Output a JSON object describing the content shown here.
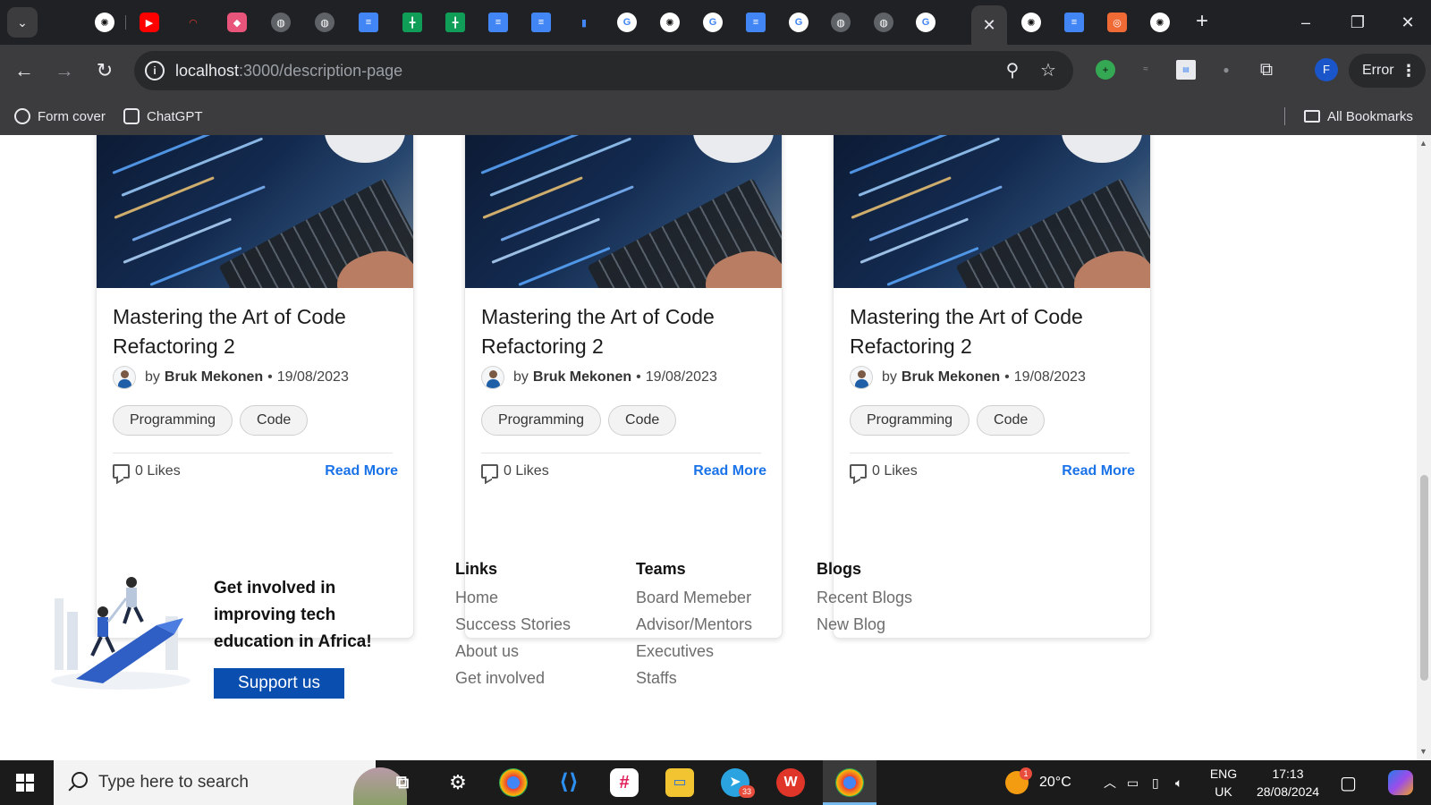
{
  "browser": {
    "url_host": "localhost",
    "url_path": ":3000/description-page",
    "profile_initial": "F",
    "error_label": "Error",
    "bookmarks": [
      {
        "label": "Form cover"
      },
      {
        "label": "ChatGPT"
      }
    ],
    "all_bookmarks_label": "All Bookmarks",
    "window_buttons": [
      "–",
      "❐",
      "✕"
    ]
  },
  "colors": {
    "accent_link": "#1a73e8",
    "support_button": "#0a4fb0",
    "chrome_dark": "#202124",
    "chrome_toolbar": "#3c3c3e"
  },
  "cards": [
    {
      "title": "Mastering the Art of Code Refactoring 2",
      "by": "by",
      "author": "Bruk Mekonen",
      "date": "19/08/2023",
      "tags": [
        "Programming",
        "Code"
      ],
      "likes": "0 Likes",
      "read_more": "Read More"
    },
    {
      "title": "Mastering the Art of Code Refactoring 2",
      "by": "by",
      "author": "Bruk Mekonen",
      "date": "19/08/2023",
      "tags": [
        "Programming",
        "Code"
      ],
      "likes": "0 Likes",
      "read_more": "Read More"
    },
    {
      "title": "Mastering the Art of Code Refactoring 2",
      "by": "by",
      "author": "Bruk Mekonen",
      "date": "19/08/2023",
      "tags": [
        "Programming",
        "Code"
      ],
      "likes": "0 Likes",
      "read_more": "Read More"
    }
  ],
  "footer": {
    "cta_text": "Get involved in improving tech education in Africa!",
    "support_button": "Support us",
    "columns": [
      {
        "heading": "Links",
        "items": [
          "Home",
          "Success Stories",
          "About us",
          "Get involved"
        ]
      },
      {
        "heading": "Teams",
        "items": [
          "Board Memeber",
          "Advisor/Mentors",
          "Executives",
          "Staffs"
        ]
      },
      {
        "heading": "Blogs",
        "items": [
          "Recent Blogs",
          "New Blog"
        ]
      }
    ]
  },
  "taskbar": {
    "search_placeholder": "Type here to search",
    "weather_temp": "20°C",
    "weather_badge": "1",
    "telegram_badge": "33",
    "lang_top": "ENG",
    "lang_bottom": "UK",
    "time": "17:13",
    "date": "28/08/2024"
  }
}
